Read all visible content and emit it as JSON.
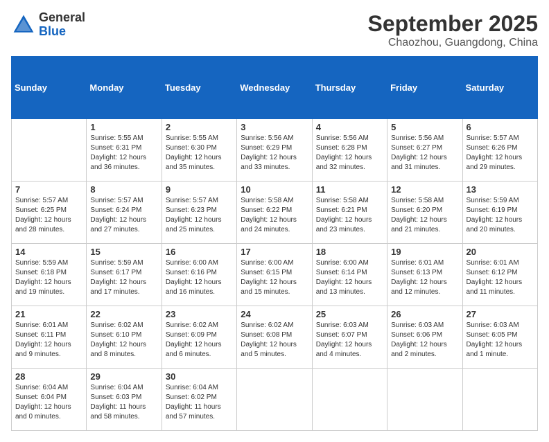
{
  "logo": {
    "general": "General",
    "blue": "Blue"
  },
  "header": {
    "month": "September 2025",
    "location": "Chaozhou, Guangdong, China"
  },
  "weekdays": [
    "Sunday",
    "Monday",
    "Tuesday",
    "Wednesday",
    "Thursday",
    "Friday",
    "Saturday"
  ],
  "weeks": [
    [
      {
        "day": "",
        "info": ""
      },
      {
        "day": "1",
        "info": "Sunrise: 5:55 AM\nSunset: 6:31 PM\nDaylight: 12 hours\nand 36 minutes."
      },
      {
        "day": "2",
        "info": "Sunrise: 5:55 AM\nSunset: 6:30 PM\nDaylight: 12 hours\nand 35 minutes."
      },
      {
        "day": "3",
        "info": "Sunrise: 5:56 AM\nSunset: 6:29 PM\nDaylight: 12 hours\nand 33 minutes."
      },
      {
        "day": "4",
        "info": "Sunrise: 5:56 AM\nSunset: 6:28 PM\nDaylight: 12 hours\nand 32 minutes."
      },
      {
        "day": "5",
        "info": "Sunrise: 5:56 AM\nSunset: 6:27 PM\nDaylight: 12 hours\nand 31 minutes."
      },
      {
        "day": "6",
        "info": "Sunrise: 5:57 AM\nSunset: 6:26 PM\nDaylight: 12 hours\nand 29 minutes."
      }
    ],
    [
      {
        "day": "7",
        "info": "Sunrise: 5:57 AM\nSunset: 6:25 PM\nDaylight: 12 hours\nand 28 minutes."
      },
      {
        "day": "8",
        "info": "Sunrise: 5:57 AM\nSunset: 6:24 PM\nDaylight: 12 hours\nand 27 minutes."
      },
      {
        "day": "9",
        "info": "Sunrise: 5:57 AM\nSunset: 6:23 PM\nDaylight: 12 hours\nand 25 minutes."
      },
      {
        "day": "10",
        "info": "Sunrise: 5:58 AM\nSunset: 6:22 PM\nDaylight: 12 hours\nand 24 minutes."
      },
      {
        "day": "11",
        "info": "Sunrise: 5:58 AM\nSunset: 6:21 PM\nDaylight: 12 hours\nand 23 minutes."
      },
      {
        "day": "12",
        "info": "Sunrise: 5:58 AM\nSunset: 6:20 PM\nDaylight: 12 hours\nand 21 minutes."
      },
      {
        "day": "13",
        "info": "Sunrise: 5:59 AM\nSunset: 6:19 PM\nDaylight: 12 hours\nand 20 minutes."
      }
    ],
    [
      {
        "day": "14",
        "info": "Sunrise: 5:59 AM\nSunset: 6:18 PM\nDaylight: 12 hours\nand 19 minutes."
      },
      {
        "day": "15",
        "info": "Sunrise: 5:59 AM\nSunset: 6:17 PM\nDaylight: 12 hours\nand 17 minutes."
      },
      {
        "day": "16",
        "info": "Sunrise: 6:00 AM\nSunset: 6:16 PM\nDaylight: 12 hours\nand 16 minutes."
      },
      {
        "day": "17",
        "info": "Sunrise: 6:00 AM\nSunset: 6:15 PM\nDaylight: 12 hours\nand 15 minutes."
      },
      {
        "day": "18",
        "info": "Sunrise: 6:00 AM\nSunset: 6:14 PM\nDaylight: 12 hours\nand 13 minutes."
      },
      {
        "day": "19",
        "info": "Sunrise: 6:01 AM\nSunset: 6:13 PM\nDaylight: 12 hours\nand 12 minutes."
      },
      {
        "day": "20",
        "info": "Sunrise: 6:01 AM\nSunset: 6:12 PM\nDaylight: 12 hours\nand 11 minutes."
      }
    ],
    [
      {
        "day": "21",
        "info": "Sunrise: 6:01 AM\nSunset: 6:11 PM\nDaylight: 12 hours\nand 9 minutes."
      },
      {
        "day": "22",
        "info": "Sunrise: 6:02 AM\nSunset: 6:10 PM\nDaylight: 12 hours\nand 8 minutes."
      },
      {
        "day": "23",
        "info": "Sunrise: 6:02 AM\nSunset: 6:09 PM\nDaylight: 12 hours\nand 6 minutes."
      },
      {
        "day": "24",
        "info": "Sunrise: 6:02 AM\nSunset: 6:08 PM\nDaylight: 12 hours\nand 5 minutes."
      },
      {
        "day": "25",
        "info": "Sunrise: 6:03 AM\nSunset: 6:07 PM\nDaylight: 12 hours\nand 4 minutes."
      },
      {
        "day": "26",
        "info": "Sunrise: 6:03 AM\nSunset: 6:06 PM\nDaylight: 12 hours\nand 2 minutes."
      },
      {
        "day": "27",
        "info": "Sunrise: 6:03 AM\nSunset: 6:05 PM\nDaylight: 12 hours\nand 1 minute."
      }
    ],
    [
      {
        "day": "28",
        "info": "Sunrise: 6:04 AM\nSunset: 6:04 PM\nDaylight: 12 hours\nand 0 minutes."
      },
      {
        "day": "29",
        "info": "Sunrise: 6:04 AM\nSunset: 6:03 PM\nDaylight: 11 hours\nand 58 minutes."
      },
      {
        "day": "30",
        "info": "Sunrise: 6:04 AM\nSunset: 6:02 PM\nDaylight: 11 hours\nand 57 minutes."
      },
      {
        "day": "",
        "info": ""
      },
      {
        "day": "",
        "info": ""
      },
      {
        "day": "",
        "info": ""
      },
      {
        "day": "",
        "info": ""
      }
    ]
  ]
}
